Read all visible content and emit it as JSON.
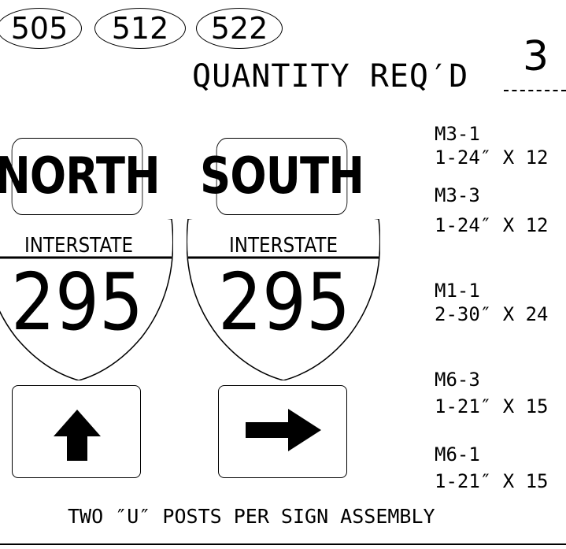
{
  "sheet_refs": [
    "505",
    "512",
    "522"
  ],
  "quantity": {
    "label": "QUANTITY REQ′D",
    "value": "3"
  },
  "assemblies": [
    {
      "direction": "NORTH",
      "shield_top": "INTERSTATE",
      "route": "295",
      "arrow": "up"
    },
    {
      "direction": "SOUTH",
      "shield_top": "INTERSTATE",
      "route": "295",
      "arrow": "right"
    }
  ],
  "signs": [
    {
      "code": "M3-1",
      "size": "1-24″ X 12"
    },
    {
      "code": "M3-3",
      "size": "1-24″ X 12"
    },
    {
      "code": "M1-1",
      "size": "2-30″ X 24"
    },
    {
      "code": "M6-3",
      "size": "1-21″ X 15"
    },
    {
      "code": "M6-1",
      "size": "1-21″ X 15"
    }
  ],
  "note": "TWO ″U″ POSTS PER SIGN ASSEMBLY"
}
